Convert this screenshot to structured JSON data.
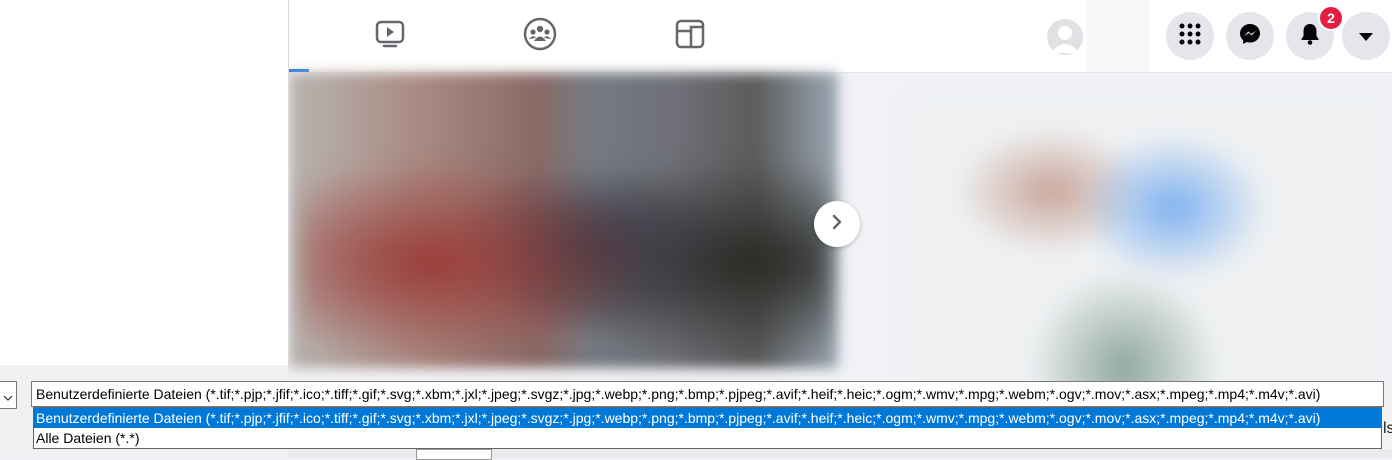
{
  "topbar": {
    "tabs": [
      {
        "icon": "watch-icon",
        "active": false
      },
      {
        "icon": "groups-icon",
        "active": false
      },
      {
        "icon": "gaming-icon",
        "active": false
      }
    ],
    "notification_count": "2",
    "colors": {
      "accent": "#1877f2",
      "badge": "#e41e3f",
      "button_bg": "#e4e6eb"
    }
  },
  "file_dialog": {
    "file_type_value": "Benutzerdefinierte Dateien (*.tif;*.pjp;*.jfif;*.ico;*.tiff;*.gif;*.svg;*.xbm;*.jxl;*.jpeg;*.svgz;*.jpg;*.webp;*.png;*.bmp;*.pjpeg;*.avif;*.heif;*.heic;*.ogm;*.wmv;*.mpg;*.webm;*.ogv;*.mov;*.asx;*.mpeg;*.mp4;*.m4v;*.avi)",
    "options": [
      "Benutzerdefinierte Dateien (*.tif;*.pjp;*.jfif;*.ico;*.tiff;*.gif;*.svg;*.xbm;*.jxl;*.jpeg;*.svgz;*.jpg;*.webp;*.png;*.bmp;*.pjpeg;*.avif;*.heif;*.heic;*.ogm;*.wmv;*.mpg;*.webm;*.ogv;*.mov;*.asx;*.mpeg;*.mp4;*.m4v;*.avi)",
      "Alle Dateien (*.*)"
    ],
    "selected_color": "#0078d7"
  },
  "page": {
    "trailing_text": "ls"
  }
}
